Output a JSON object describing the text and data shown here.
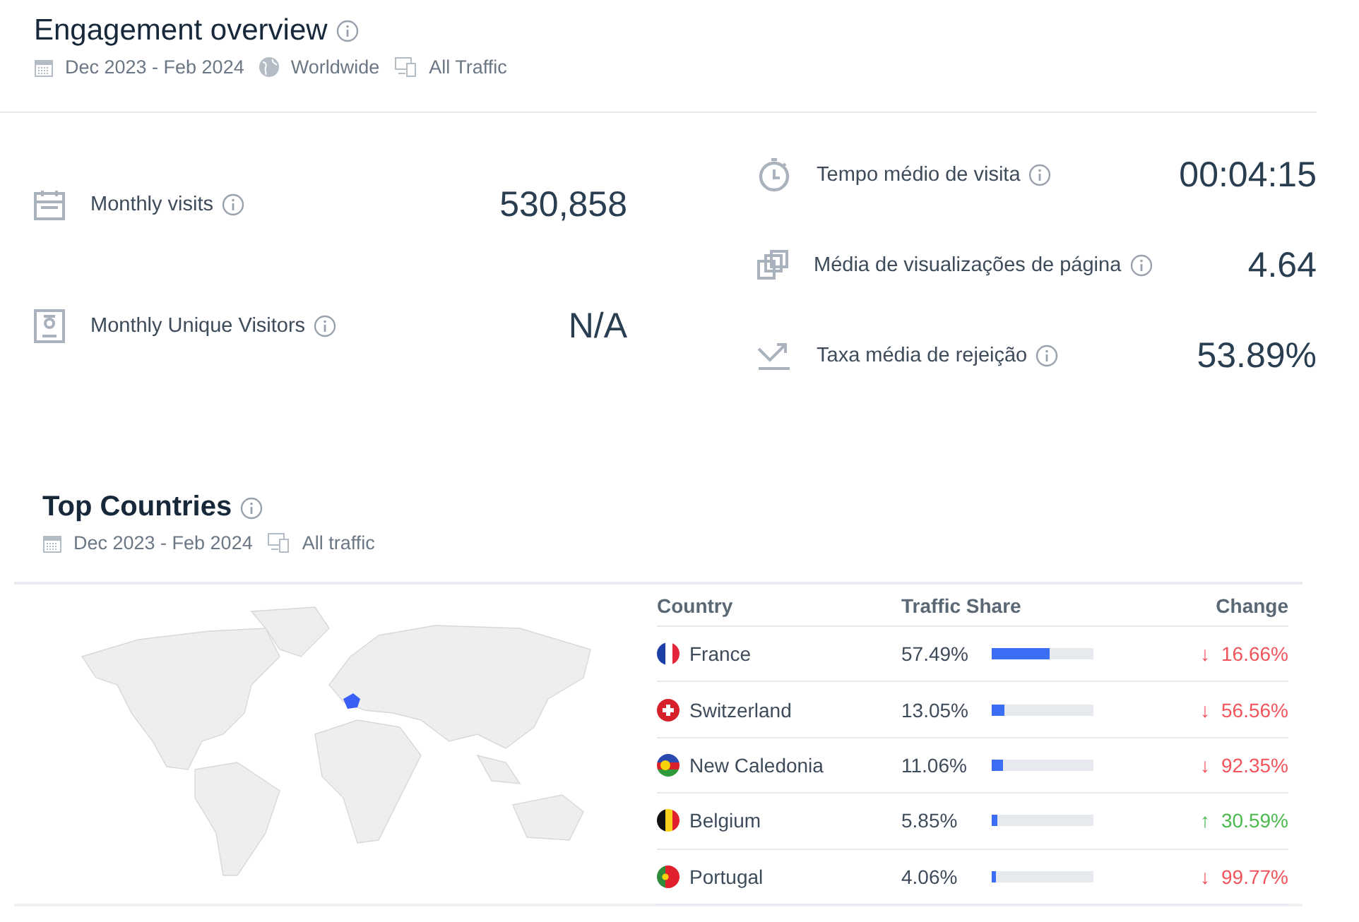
{
  "engagement": {
    "title": "Engagement overview",
    "filters": [
      {
        "kind": "date",
        "label": "Dec 2023 - Feb 2024"
      },
      {
        "kind": "globe",
        "label": "Worldwide"
      },
      {
        "kind": "devices",
        "label": "All Traffic"
      }
    ],
    "left_metrics": [
      {
        "kind": "calendar",
        "label": "Monthly visits",
        "value": "530,858"
      },
      {
        "kind": "person",
        "label": "Monthly Unique Visitors",
        "value": "N/A"
      }
    ],
    "right_metrics": [
      {
        "kind": "timer",
        "label": "Tempo médio de visita",
        "value": "00:04:15"
      },
      {
        "kind": "pages",
        "label": "Média de visualizações de página",
        "value": "4.64"
      },
      {
        "kind": "bounce",
        "label": "Taxa média de rejeição",
        "value": "53.89%"
      }
    ]
  },
  "top_countries": {
    "title": "Top Countries",
    "filters": [
      {
        "kind": "date",
        "label": "Dec 2023 - Feb 2024"
      },
      {
        "kind": "devices",
        "label": "All traffic"
      }
    ],
    "columns": [
      "Country",
      "Traffic Share",
      "Change"
    ],
    "rows": [
      {
        "kind": "fr",
        "country": "France",
        "share": "57.49%",
        "level": 0.5749,
        "arrow": "↓",
        "change": "16.66%",
        "color": "#f2545b"
      },
      {
        "kind": "ch",
        "country": "Switzerland",
        "share": "13.05%",
        "level": 0.1305,
        "arrow": "↓",
        "change": "56.56%",
        "color": "#f2545b"
      },
      {
        "kind": "nc",
        "country": "New Caledonia",
        "share": "11.06%",
        "level": 0.1106,
        "arrow": "↓",
        "change": "92.35%",
        "color": "#f2545b"
      },
      {
        "kind": "be",
        "country": "Belgium",
        "share": "5.85%",
        "level": 0.0585,
        "arrow": "↑",
        "change": "30.59%",
        "color": "#4cb84f"
      },
      {
        "kind": "pt",
        "country": "Portugal",
        "share": "4.06%",
        "level": 0.0406,
        "arrow": "↓",
        "change": "99.77%",
        "color": "#f2545b"
      }
    ]
  }
}
